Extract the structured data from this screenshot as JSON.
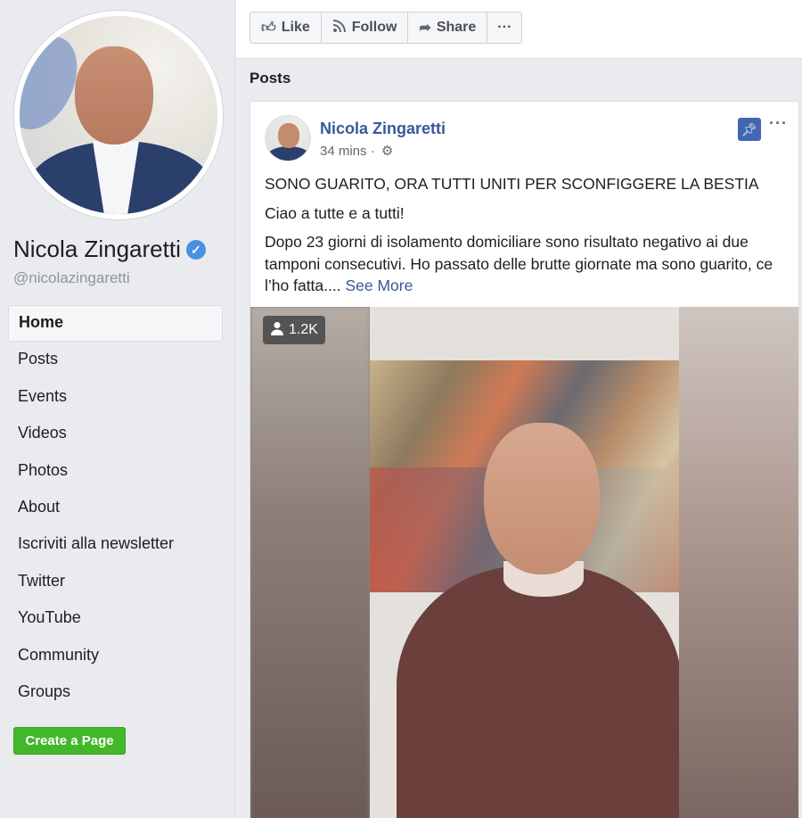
{
  "sidebar": {
    "page_name": "Nicola Zingaretti",
    "handle": "@nicolazingaretti",
    "verified_icon": "check-icon",
    "nav": [
      {
        "label": "Home",
        "active": true
      },
      {
        "label": "Posts"
      },
      {
        "label": "Events"
      },
      {
        "label": "Videos"
      },
      {
        "label": "Photos"
      },
      {
        "label": "About"
      },
      {
        "label": "Iscriviti alla newsletter"
      },
      {
        "label": "Twitter"
      },
      {
        "label": "YouTube"
      },
      {
        "label": "Community"
      },
      {
        "label": "Groups"
      }
    ],
    "create_page": "Create a Page"
  },
  "actions": {
    "like": "Like",
    "follow": "Follow",
    "share": "Share",
    "more": "···"
  },
  "posts_heading": "Posts",
  "post": {
    "author": "Nicola Zingaretti",
    "time": "34 mins ·",
    "headline": "SONO GUARITO, ORA TUTTI UNITI PER SCONFIGGERE LA BESTIA",
    "greeting": "Ciao a tutte e a tutti!",
    "body": "Dopo 23 giorni di isolamento domiciliare sono risultato negativo ai due tamponi consecutivi. Ho passato delle brutte giornate ma sono guarito, ce l’ho fatta.... ",
    "see_more": "See More",
    "more": "···",
    "video": {
      "viewers": "1.2K"
    }
  },
  "colors": {
    "link": "#385898",
    "create_button": "#42b72a",
    "pin": "#4267b2",
    "verified": "#4a90e2"
  }
}
